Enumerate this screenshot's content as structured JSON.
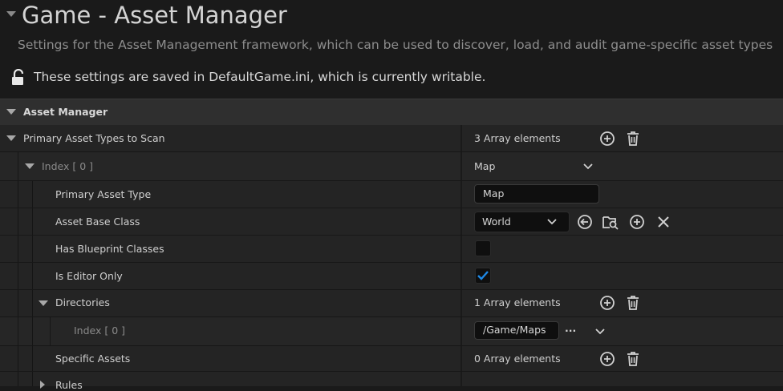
{
  "header": {
    "title": "Game - Asset Manager",
    "subtitle": "Settings for the Asset Management framework, which can be used to discover, load, and audit game-specific asset types",
    "saved_info": "These settings are saved in DefaultGame.ini, which is currently writable."
  },
  "category": {
    "label": "Asset Manager"
  },
  "rows": {
    "primary_asset_types": {
      "label": "Primary Asset Types to Scan",
      "value": "3 Array elements"
    },
    "index0": {
      "label": "Index [ 0 ]",
      "value": "Map"
    },
    "primary_asset_type": {
      "label": "Primary Asset Type",
      "value": "Map"
    },
    "asset_base_class": {
      "label": "Asset Base Class",
      "value": "World"
    },
    "has_blueprint": {
      "label": "Has Blueprint Classes",
      "checked": false
    },
    "is_editor_only": {
      "label": "Is Editor Only",
      "checked": true
    },
    "directories": {
      "label": "Directories",
      "value": "1 Array elements"
    },
    "dir_index0": {
      "label": "Index [ 0 ]",
      "value": "/Game/Maps",
      "more": "..."
    },
    "specific_assets": {
      "label": "Specific Assets",
      "value": "0 Array elements"
    },
    "rules": {
      "label": "Rules"
    }
  },
  "colors": {
    "accent_check": "#1e88e5",
    "background": "#1a1a1a",
    "row": "#242424"
  }
}
